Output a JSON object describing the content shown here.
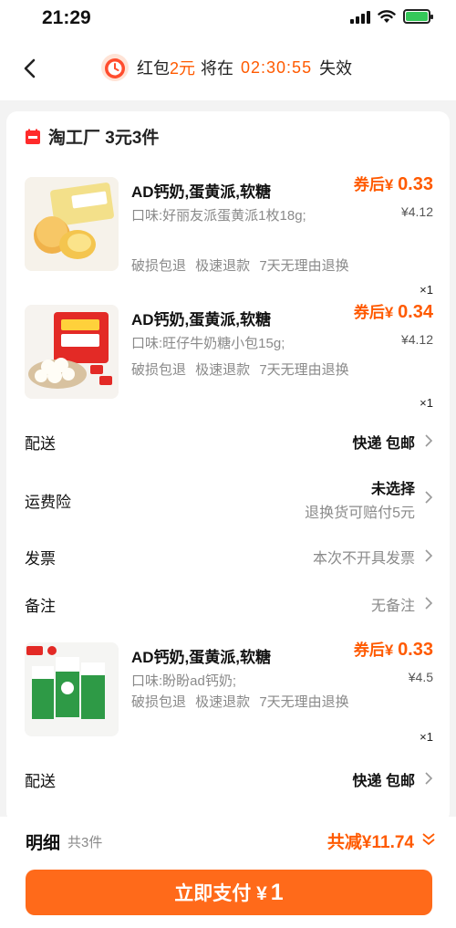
{
  "status_bar": {
    "time": "21:29"
  },
  "header": {
    "prefix": "红包",
    "amount": "2元",
    "mid": "将在",
    "countdown": "02:30:55",
    "suffix": "失效"
  },
  "shop": {
    "name": "淘工厂 3元3件"
  },
  "items": [
    {
      "title": "AD钙奶,蛋黄派,软糖",
      "spec": "口味:好丽友派蛋黄派1枚18g;",
      "tags": "破损包退 极速退款 7天无理由退换",
      "price_prefix": "券后¥",
      "price": "0.33",
      "orig_price": "¥4.12",
      "qty": "×1"
    },
    {
      "title": "AD钙奶,蛋黄派,软糖",
      "spec": "口味:旺仔牛奶糖小包15g;",
      "tags": "破损包退 极速退款 7天无理由退换",
      "price_prefix": "券后¥",
      "price": "0.34",
      "orig_price": "¥4.12",
      "qty": "×1"
    },
    {
      "title": "AD钙奶,蛋黄派,软糖",
      "spec": "口味:盼盼ad钙奶;",
      "tags": "破损包退 极速退款 7天无理由退换",
      "price_prefix": "券后¥",
      "price": "0.33",
      "orig_price": "¥4.5",
      "qty": "×1"
    }
  ],
  "rows": {
    "delivery_label": "配送",
    "delivery_value": "快递 包邮",
    "insurance_label": "运费险",
    "insurance_value": "未选择",
    "insurance_sub": "退换货可赔付5元",
    "invoice_label": "发票",
    "invoice_value": "本次不开具发票",
    "note_label": "备注",
    "note_value": "无备注",
    "delivery2_label": "配送",
    "delivery2_value": "快递 包邮"
  },
  "bottom": {
    "detail_label": "明细",
    "detail_count": "共3件",
    "saving": "共减¥11.74",
    "pay_label": "立即支付 ¥",
    "pay_amount": "1"
  },
  "colors": {
    "accent": "#ff5a00",
    "pay_button": "#ff6a1a"
  }
}
